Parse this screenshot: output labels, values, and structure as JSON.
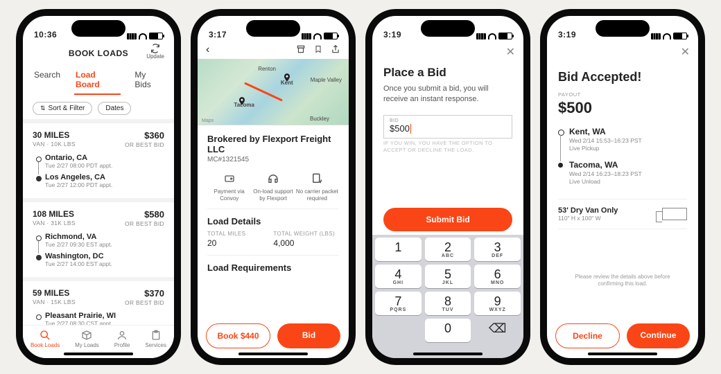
{
  "accent": "#fa4616",
  "screen1": {
    "time": "10:36",
    "title": "BOOK LOADS",
    "refresh_label": "Update",
    "tabs": [
      "Search",
      "Load Board",
      "My Bids"
    ],
    "active_tab": 1,
    "filter_pill": "Sort & Filter",
    "dates_pill": "Dates",
    "cards": [
      {
        "miles": "30 MILES",
        "sub": "VAN · 10K LBS",
        "price": "$360",
        "price_sub": "OR BEST BID",
        "stops": [
          {
            "city": "Ontario, CA",
            "appt": "Tue 2/27 08:00 PDT appt."
          },
          {
            "city": "Los Angeles, CA",
            "appt": "Tue 2/27 12:00 PDT appt."
          }
        ]
      },
      {
        "miles": "108 MILES",
        "sub": "VAN · 31K LBS",
        "price": "$580",
        "price_sub": "OR BEST BID",
        "stops": [
          {
            "city": "Richmond, VA",
            "appt": "Tue 2/27 09:30 EST appt."
          },
          {
            "city": "Washington, DC",
            "appt": "Tue 2/27 14:00 EST appt."
          }
        ]
      },
      {
        "miles": "59 MILES",
        "sub": "VAN · 15K LBS",
        "price": "$370",
        "price_sub": "OR BEST BID",
        "stops": [
          {
            "city": "Pleasant Prairie, WI",
            "appt": "Tue 2/27 08:30 CST appt."
          }
        ]
      }
    ],
    "tabbar": [
      "Book Loads",
      "My Loads",
      "Profile",
      "Services"
    ]
  },
  "screen2": {
    "time": "3:17",
    "map_labels": {
      "kent": "Kent",
      "tacoma": "Tacoma",
      "renton": "Renton",
      "maple": "Maple Valley",
      "buckley": "Buckley",
      "attrib": "Maps"
    },
    "broker": "Brokered by Flexport Freight LLC",
    "mc": "MC#1321545",
    "features": [
      {
        "label": "Payment via Convoy"
      },
      {
        "label": "On-load support by Flexport"
      },
      {
        "label": "No carrier packet required"
      }
    ],
    "details_heading": "Load Details",
    "total_miles_lbl": "TOTAL MILES",
    "total_miles": "20",
    "total_weight_lbl": "TOTAL WEIGHT (LBS)",
    "total_weight": "4,000",
    "req_heading": "Load Requirements",
    "book_btn": "Book $440",
    "bid_btn": "Bid"
  },
  "screen3": {
    "time": "3:19",
    "title": "Place a Bid",
    "subtitle": "Once you submit a bid, you will receive an instant response.",
    "bid_label": "BID",
    "bid_value": "$500",
    "note": "IF YOU WIN, YOU HAVE THE OPTION TO ACCEPT OR DECLINE THE LOAD.",
    "submit": "Submit Bid",
    "keys": [
      [
        "1",
        ""
      ],
      [
        "2",
        "ABC"
      ],
      [
        "3",
        "DEF"
      ],
      [
        "4",
        "GHI"
      ],
      [
        "5",
        "JKL"
      ],
      [
        "6",
        "MNO"
      ],
      [
        "7",
        "PQRS"
      ],
      [
        "8",
        "TUV"
      ],
      [
        "9",
        "WXYZ"
      ],
      [
        "",
        ""
      ],
      [
        "0",
        ""
      ],
      [
        "⌫",
        ""
      ]
    ]
  },
  "screen4": {
    "time": "3:19",
    "title": "Bid Accepted!",
    "payout_lbl": "PAYOUT",
    "payout": "$500",
    "stops": [
      {
        "city": "Kent, WA",
        "time": "Wed 2/14 15:53–16:23 PST",
        "type": "Live Pickup"
      },
      {
        "city": "Tacoma, WA",
        "time": "Wed 2/14 16:23–18:23 PST",
        "type": "Live Unload"
      }
    ],
    "equip_title": "53' Dry Van Only",
    "equip_sub": "110\" H x 100\" W",
    "note": "Please review the details above before confirming this load.",
    "decline_btn": "Decline",
    "continue_btn": "Continue"
  }
}
